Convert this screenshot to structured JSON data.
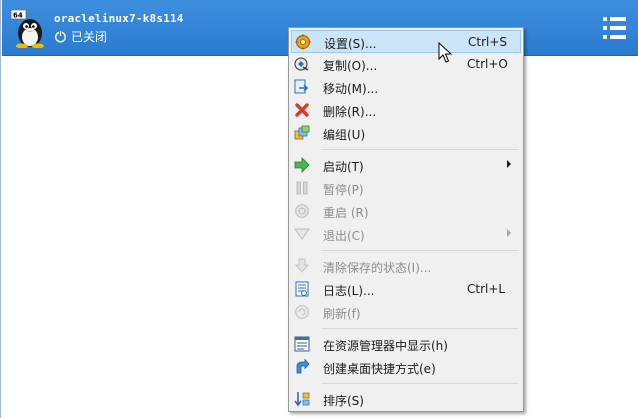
{
  "vm": {
    "badge": "64",
    "name": "oraclelinux7-k8s114",
    "status": "已关闭"
  },
  "menu": {
    "groups": [
      [
        {
          "label": "设置(S)...",
          "shortcut": "Ctrl+S",
          "icon": "settings-gear-icon",
          "enabled": true,
          "highlighted": true
        },
        {
          "label": "复制(O)...",
          "shortcut": "Ctrl+O",
          "icon": "clone-icon",
          "enabled": true
        },
        {
          "label": "移动(M)...",
          "shortcut": "",
          "icon": "move-icon",
          "enabled": true
        },
        {
          "label": "删除(R)...",
          "shortcut": "",
          "icon": "delete-x-icon",
          "enabled": true
        },
        {
          "label": "编组(U)",
          "shortcut": "",
          "icon": "group-icon",
          "enabled": true
        }
      ],
      [
        {
          "label": "启动(T)",
          "shortcut": "",
          "icon": "start-arrow-icon",
          "enabled": true,
          "submenu": true
        },
        {
          "label": "暂停(P)",
          "shortcut": "",
          "icon": "pause-icon",
          "enabled": false
        },
        {
          "label": "重启 (R)",
          "shortcut": "",
          "icon": "reset-icon",
          "enabled": false
        },
        {
          "label": "退出(C)",
          "shortcut": "",
          "icon": "exit-triangle-icon",
          "enabled": false,
          "submenu": true
        }
      ],
      [
        {
          "label": "清除保存的状态(I)...",
          "shortcut": "",
          "icon": "discard-state-icon",
          "enabled": false
        },
        {
          "label": "日志(L)...",
          "shortcut": "Ctrl+L",
          "icon": "log-icon",
          "enabled": true
        },
        {
          "label": "刷新(f)",
          "shortcut": "",
          "icon": "refresh-icon",
          "enabled": false
        }
      ],
      [
        {
          "label": "在资源管理器中显示(h)",
          "shortcut": "",
          "icon": "explorer-icon",
          "enabled": true
        },
        {
          "label": "创建桌面快捷方式(e)",
          "shortcut": "",
          "icon": "shortcut-icon",
          "enabled": true
        }
      ],
      [
        {
          "label": "排序(S)",
          "shortcut": "",
          "icon": "sort-icon",
          "enabled": true
        }
      ]
    ]
  },
  "colors": {
    "row_bg": "#2a7bd0",
    "menu_bg": "#f0f0f0",
    "highlight": "#cce4f7"
  }
}
